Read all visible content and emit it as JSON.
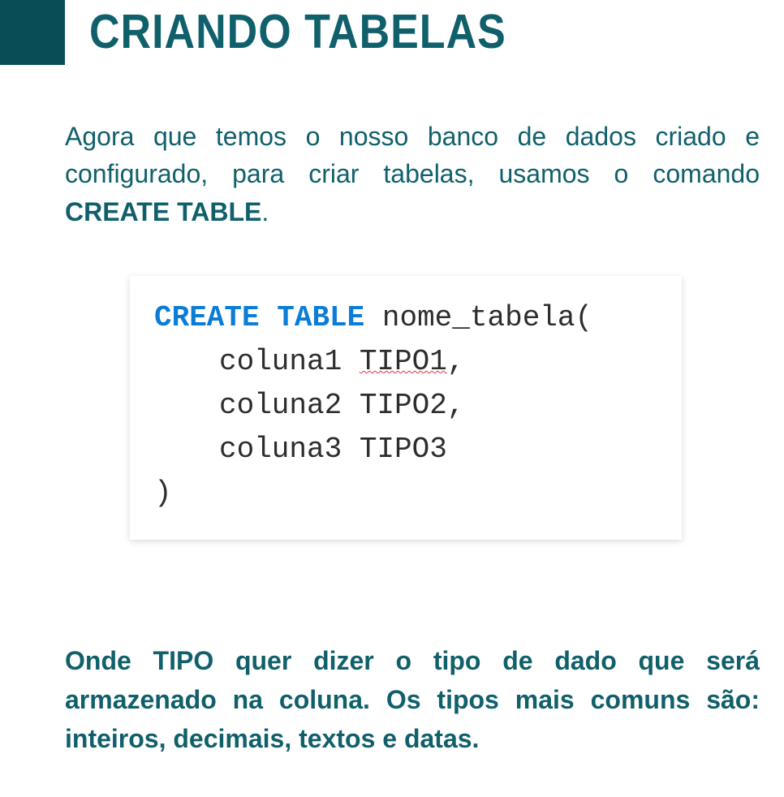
{
  "title": "CRIANDO TABELAS",
  "intro": {
    "text_part1": "Agora que temos o nosso banco de dados criado e configurado, para criar tabelas, usamos o comando ",
    "bold_command": "CREATE TABLE",
    "text_part2": "."
  },
  "code": {
    "keyword1": "CREATE",
    "keyword2": "TABLE",
    "line1_rest": " nome_tabela(",
    "line2_col": "coluna1 ",
    "line2_type": "TIPO1",
    "line2_comma": ",",
    "line3": "coluna2 TIPO2,",
    "line4": "coluna3 TIPO3",
    "line5": ")"
  },
  "footer": "Onde TIPO quer dizer o tipo de dado  que será armazenado na coluna. Os tipos mais comuns são: inteiros, decimais, textos e datas."
}
